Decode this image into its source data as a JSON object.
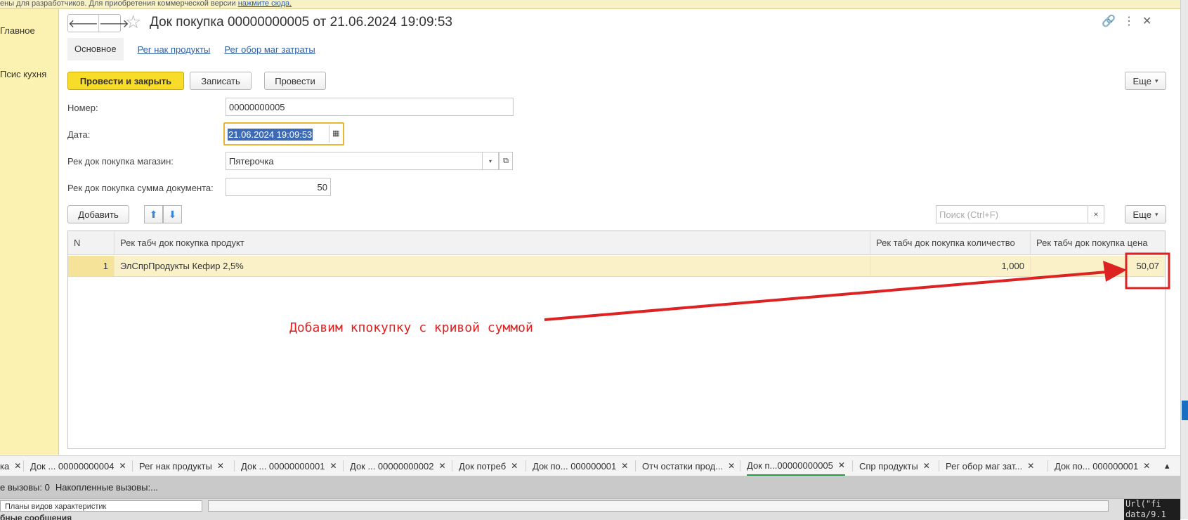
{
  "top_strip": {
    "text": "ены для разработчиков. Для приобретения коммерческой версии ",
    "link": "нажмите сюда."
  },
  "left_panel": {
    "items": [
      "Главное",
      "Псис кухня"
    ]
  },
  "header": {
    "back_glyph": "🡐",
    "forward_glyph": "🡒",
    "star_glyph": "☆",
    "title": "Док покупка 00000000005 от 21.06.2024 19:09:53",
    "link_glyph": "🔗",
    "menu_glyph": "⋮",
    "close_glyph": "✕"
  },
  "tabs": [
    "Основное",
    "Рег нак продукты",
    "Рег обор маг затраты"
  ],
  "toolbar": {
    "post_close": "Провести и закрыть",
    "save": "Записать",
    "post": "Провести",
    "more": "Еще"
  },
  "fields": {
    "number_label": "Номер:",
    "number_value": "00000000005",
    "date_label": "Дата:",
    "date_value": "21.06.2024 19:09:53",
    "store_label": "Рек док покупка магазин:",
    "store_value": "Пятерочка",
    "sum_label": "Рек док покупка сумма документа:",
    "sum_value": "50"
  },
  "table_toolbar": {
    "add": "Добавить",
    "up_glyph": "⬆",
    "down_glyph": "⬇",
    "search_placeholder": "Поиск (Ctrl+F)",
    "clear_glyph": "×",
    "more": "Еще"
  },
  "table": {
    "columns": [
      "N",
      "Рек табч док покупка продукт",
      "Рек табч док покупка количество",
      "Рек табч док покупка цена"
    ],
    "rows": [
      {
        "n": "1",
        "product": "ЭлСпрПродукты Кефир 2,5%",
        "quantity": "1,000",
        "price": "50,07"
      }
    ]
  },
  "annotation": {
    "text": "Добавим кпокупку с кривой суммой",
    "color": "#dd2222"
  },
  "bottom_tabs": [
    {
      "label": "ка",
      "active": false
    },
    {
      "label": "Док ... 00000000004",
      "active": false
    },
    {
      "label": "Рег нак продукты",
      "active": false
    },
    {
      "label": "Док ... 00000000001",
      "active": false
    },
    {
      "label": "Док ... 00000000002",
      "active": false
    },
    {
      "label": "Док потреб",
      "active": false
    },
    {
      "label": "Док по... 000000001",
      "active": false
    },
    {
      "label": "Отч остатки прод...",
      "active": false
    },
    {
      "label": "Док п...00000000005",
      "active": true
    },
    {
      "label": "Спр продукты",
      "active": false
    },
    {
      "label": "Рег обор маг зат...",
      "active": false
    },
    {
      "label": "Док по... 000000001",
      "active": false
    }
  ],
  "status": {
    "calls": "е вызовы: 0",
    "accumulated": "Накопленные вызовы:..."
  },
  "lower": {
    "combo_value": "Планы видов характеристик",
    "messages": "бные сообщения",
    "code1": "Url(\"fi",
    "code2": "data/9.1"
  },
  "colors": {
    "primary_button": "#f8dc2a",
    "left_panel": "#fbf1b0",
    "selected_row": "#fbf1c8",
    "annotation": "#dd2222",
    "active_tab_underline": "#2a9a4a"
  }
}
